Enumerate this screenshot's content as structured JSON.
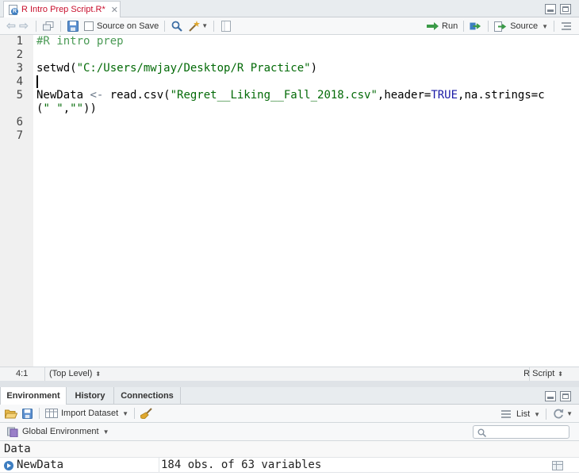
{
  "editor": {
    "tab_label": "R Intro Prep Script.R*",
    "toolbar": {
      "source_on_save_label": "Source on Save",
      "run_label": "Run",
      "source_label": "Source"
    },
    "line_numbers": [
      "1",
      "2",
      "3",
      "4",
      "5",
      "",
      "6",
      "7"
    ],
    "code": {
      "line1_comment": "#R intro prep",
      "line3_func": "setwd(",
      "line3_string": "\"C:/Users/mwjay/Desktop/R Practice\"",
      "line3_close": ")",
      "line5_var": "NewData ",
      "line5_assign": "<-",
      "line5_call": " read.csv(",
      "line5_string": "\"Regret__Liking__Fall_2018.csv\"",
      "line5_arg1": ",header=",
      "line5_true": "TRUE",
      "line5_arg2": ",na.strings=c",
      "line5_wrap_open": "(",
      "line5_wrap_str1": "\" \"",
      "line5_wrap_comma": ",",
      "line5_wrap_str2": "\"\"",
      "line5_wrap_close": "))"
    },
    "status": {
      "position": "4:1",
      "scope": "(Top Level)",
      "file_type": "R Script"
    }
  },
  "environment": {
    "tabs": [
      "Environment",
      "History",
      "Connections"
    ],
    "active_tab": "Environment",
    "toolbar": {
      "import_label": "Import Dataset",
      "view_label": "List"
    },
    "scope_label": "Global Environment",
    "search_placeholder": "",
    "section_header": "Data",
    "rows": [
      {
        "name": "NewData",
        "value": "184 obs. of 63 variables"
      }
    ]
  },
  "colors": {
    "accent_blue": "#3e7ec1",
    "run_green": "#3a9a47",
    "string_green": "#036a07",
    "keyword_blue": "#1a1aa6",
    "modified_tab_red": "#c8102e"
  }
}
